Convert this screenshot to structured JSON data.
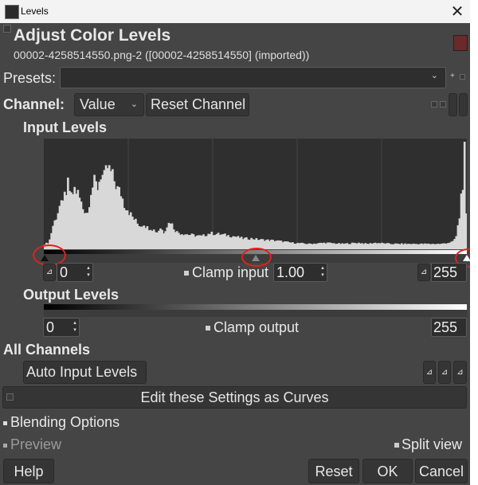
{
  "window": {
    "title": "Levels",
    "close_glyph": "✕"
  },
  "header": {
    "title": "Adjust Color Levels",
    "subtitle": "00002-4258514550.png-2 ([00002-4258514550] (imported))"
  },
  "presets": {
    "label": "Presets:",
    "value": "",
    "add_glyph": "+"
  },
  "channel": {
    "label": "Channel:",
    "selected": "Value",
    "reset_label": "Reset Channel"
  },
  "input_levels": {
    "heading": "Input Levels",
    "low": "0",
    "gamma": "1.00",
    "high": "255",
    "clamp_label": "Clamp input"
  },
  "output_levels": {
    "heading": "Output Levels",
    "low": "0",
    "high": "255",
    "clamp_label": "Clamp output"
  },
  "all_channels": {
    "heading": "All Channels",
    "auto_label": "Auto Input Levels"
  },
  "curves_label": "Edit these Settings as Curves",
  "blending_label": "Blending Options",
  "preview_label": "Preview",
  "split_view_label": "Split view",
  "buttons": {
    "help": "Help",
    "reset": "Reset",
    "ok": "OK",
    "cancel": "Cancel"
  },
  "histogram": {
    "bins": 256,
    "shape_points": [
      [
        0,
        0.05
      ],
      [
        2,
        0.06
      ],
      [
        3,
        0.09
      ],
      [
        5,
        0.22
      ],
      [
        7,
        0.3
      ],
      [
        9,
        0.4
      ],
      [
        11,
        0.42
      ],
      [
        12,
        0.58
      ],
      [
        13,
        0.45
      ],
      [
        14,
        0.62
      ],
      [
        16,
        0.48
      ],
      [
        18,
        0.56
      ],
      [
        20,
        0.52
      ],
      [
        23,
        0.38
      ],
      [
        26,
        0.34
      ],
      [
        28,
        0.55
      ],
      [
        30,
        0.62
      ],
      [
        32,
        0.58
      ],
      [
        34,
        0.7
      ],
      [
        36,
        0.66
      ],
      [
        38,
        0.76
      ],
      [
        40,
        0.71
      ],
      [
        42,
        0.64
      ],
      [
        44,
        0.56
      ],
      [
        46,
        0.52
      ],
      [
        48,
        0.42
      ],
      [
        50,
        0.38
      ],
      [
        52,
        0.32
      ],
      [
        54,
        0.28
      ],
      [
        56,
        0.24
      ],
      [
        58,
        0.22
      ],
      [
        60,
        0.24
      ],
      [
        62,
        0.2
      ],
      [
        64,
        0.2
      ],
      [
        66,
        0.18
      ],
      [
        68,
        0.16
      ],
      [
        70,
        0.2
      ],
      [
        72,
        0.16
      ],
      [
        74,
        0.22
      ],
      [
        76,
        0.26
      ],
      [
        78,
        0.2
      ],
      [
        80,
        0.16
      ],
      [
        82,
        0.15
      ],
      [
        86,
        0.14
      ],
      [
        90,
        0.13
      ],
      [
        95,
        0.12
      ],
      [
        100,
        0.15
      ],
      [
        105,
        0.14
      ],
      [
        110,
        0.13
      ],
      [
        115,
        0.12
      ],
      [
        120,
        0.1
      ],
      [
        125,
        0.1
      ],
      [
        130,
        0.09
      ],
      [
        140,
        0.08
      ],
      [
        150,
        0.06
      ],
      [
        160,
        0.05
      ],
      [
        170,
        0.06
      ],
      [
        180,
        0.05
      ],
      [
        190,
        0.06
      ],
      [
        195,
        0.05
      ],
      [
        200,
        0.06
      ],
      [
        210,
        0.05
      ],
      [
        220,
        0.05
      ],
      [
        230,
        0.05
      ],
      [
        240,
        0.05
      ],
      [
        244,
        0.06
      ],
      [
        247,
        0.07
      ],
      [
        249,
        0.12
      ],
      [
        251,
        0.3
      ],
      [
        252,
        0.5
      ],
      [
        253,
        0.62
      ],
      [
        254,
        1.0
      ],
      [
        255,
        0.3
      ]
    ]
  },
  "colors": {
    "accent": "#e0211e",
    "background": "#454545"
  },
  "icons": [
    "levels-app-icon",
    "close-icon",
    "image-thumbnail-icon",
    "dropdown-chevron-icon",
    "add-preset-icon",
    "preset-menu-icon",
    "pick-black-icon",
    "pick-gray-icon",
    "pick-white-icon",
    "curves-icon"
  ]
}
